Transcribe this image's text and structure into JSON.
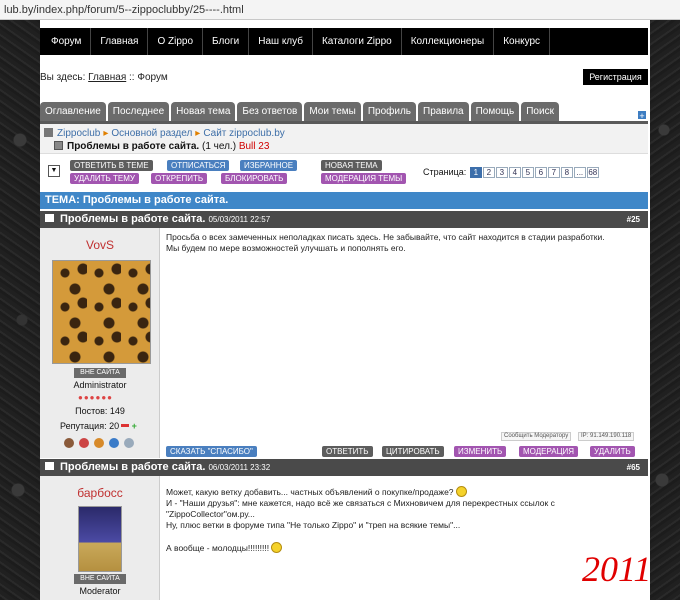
{
  "url": "lub.by/index.php/forum/5--zippoclubby/25----.html",
  "topnav": [
    "Форум",
    "Главная",
    "О Zippo",
    "Блоги",
    "Наш клуб",
    "Каталоги Zippo",
    "Коллекционеры",
    "Конкурс"
  ],
  "here": {
    "label": "Вы здесь:",
    "home": "Главная",
    "sep": "::",
    "current": "Форум"
  },
  "register": "Регистрация",
  "tabs": [
    "Оглавление",
    "Последнее",
    "Новая тема",
    "Без ответов",
    "Мои темы",
    "Профиль",
    "Правила",
    "Помощь",
    "Поиск"
  ],
  "breadcrumb": {
    "root": "Zippoclub",
    "section": "Основной раздел",
    "site": "Сайт zippoclub.by",
    "title": "Проблемы в работе сайта.",
    "count": "(1 чел.)",
    "user": "Bull 23"
  },
  "actions": {
    "reply_topic": "ОТВЕТИТЬ В ТЕМЕ",
    "unsubscribe": "ОТПИСАТЬСЯ",
    "favorite": "ИЗБРАННОЕ",
    "new_topic": "НОВАЯ ТЕМА",
    "delete_topic": "УДАЛИТЬ ТЕМУ",
    "unpin": "ОТКРЕПИТЬ",
    "block": "БЛОКИРОВАТЬ",
    "moderate_topics": "МОДЕРАЦИЯ ТЕМЫ"
  },
  "pagination": {
    "label": "Страница:",
    "pages": [
      "1",
      "2",
      "3",
      "4",
      "5",
      "6",
      "7",
      "8",
      "...",
      "68"
    ],
    "current": "1"
  },
  "theme_header": "ТЕМА: Проблемы в работе сайта.",
  "posts": [
    {
      "title": "Проблемы в работе сайта.",
      "date": "05/03/2011 22:57",
      "num": "#25",
      "user": "VovS",
      "status": "ВНЕ САЙТА",
      "role": "Administrator",
      "posts_label": "Постов: 149",
      "reputation": "Репутация: 20",
      "lines": [
        "Просьба о всех замеченных неполадках писать здесь. Не забывайте, что сайт находится в стадии разработки.",
        "Мы будем по мере возможностей улучшать и пополнять его."
      ],
      "report": "Сообщить Модератору",
      "ip": "IP: 91.149.190.118",
      "thanks": "СКАЗАТЬ \"СПАСИБО\"",
      "reply": "ОТВЕТИТЬ",
      "quote": "ЦИТИРОВАТЬ",
      "edit": "ИЗМЕНИТЬ",
      "moderate": "МОДЕРАЦИЯ",
      "delete": "УДАЛИТЬ"
    },
    {
      "title": "Проблемы в работе сайта.",
      "date": "06/03/2011 23:32",
      "num": "#65",
      "user": "барбосс",
      "status": "ВНЕ САЙТА",
      "role": "Moderator",
      "lines": [
        "Может, какую ветку добавить... частных объявлений о покупке/продаже?",
        "И - \"Наши друзья\": мне кажется, надо всё же связаться с Михновичем для перекрестных ссылок с",
        "\"ZippoCollector\"ом.ру...",
        "Ну, плюс ветки в форуме типа \"Не только Zippo\" и \"треп на всякие темы\"...",
        "",
        "А вообще - молодцы!!!!!!!!!"
      ]
    }
  ],
  "year": "2011"
}
